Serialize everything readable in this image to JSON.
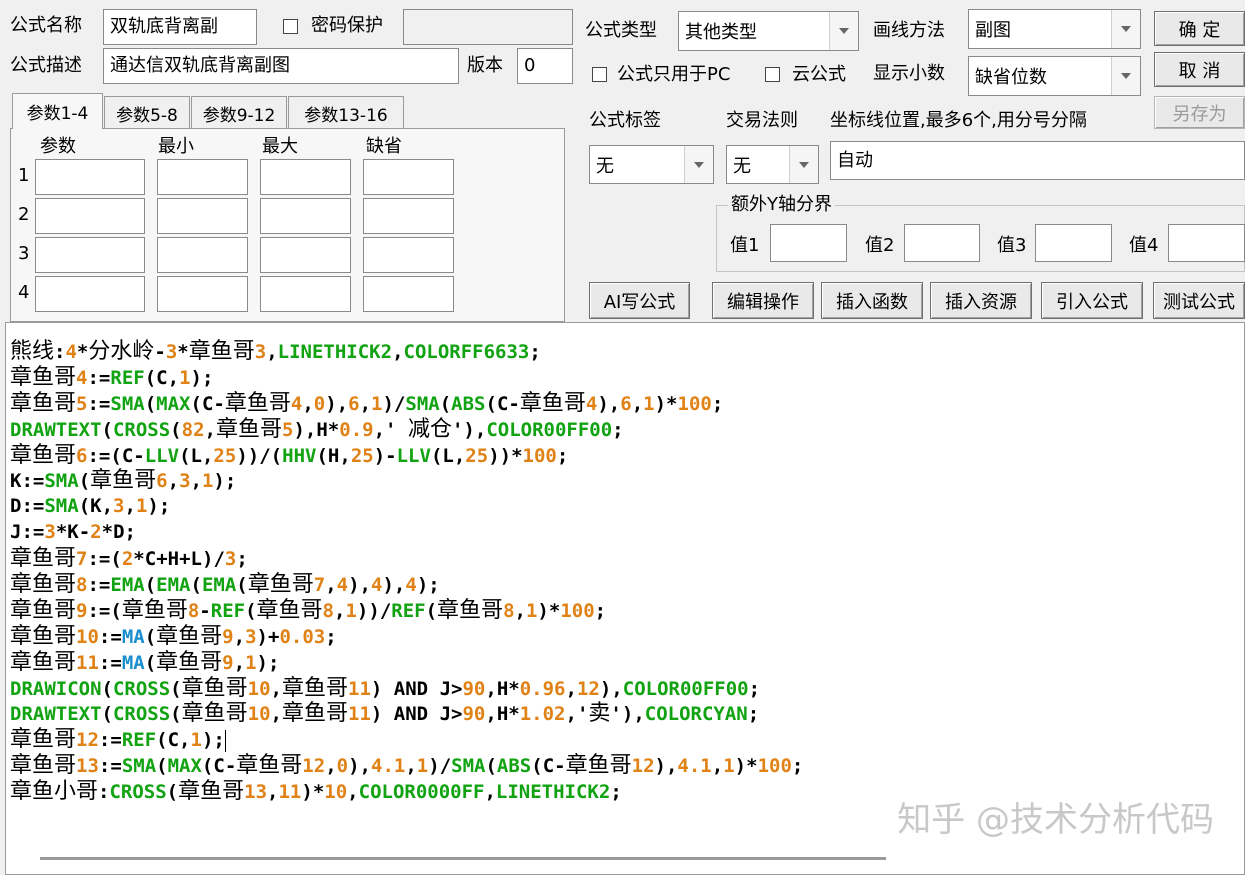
{
  "fields": {
    "name_label": "公式名称",
    "name_value": "双轨底背离副",
    "password_label": "密码保护",
    "desc_label": "公式描述",
    "desc_value": "通达信双轨底背离副图",
    "version_label": "版本",
    "version_value": "0"
  },
  "tabs": [
    "参数1-4",
    "参数5-8",
    "参数9-12",
    "参数13-16"
  ],
  "params": {
    "headers": [
      "参数",
      "最小",
      "最大",
      "缺省"
    ],
    "rows": [
      "1",
      "2",
      "3",
      "4"
    ]
  },
  "right": {
    "type_label": "公式类型",
    "type_value": "其他类型",
    "draw_label": "画线方法",
    "draw_value": "副图",
    "pc_only_label": "公式只用于PC",
    "cloud_label": "云公式",
    "decimals_label": "显示小数",
    "decimals_value": "缺省位数",
    "tag_label": "公式标签",
    "tag_value": "无",
    "trade_label": "交易法则",
    "trade_value": "无",
    "axis_label": "坐标线位置,最多6个,用分号分隔",
    "axis_value": "自动",
    "yaxis_group": "额外Y轴分界",
    "y_values": [
      "值1",
      "值2",
      "值3",
      "值4"
    ]
  },
  "buttons": {
    "ok": "确  定",
    "cancel": "取  消",
    "save_as": "另存为",
    "ai": "AI写公式",
    "edit": "编辑操作",
    "insert_func": "插入函数",
    "insert_res": "插入资源",
    "import": "引入公式",
    "test": "测试公式"
  },
  "code_lines": [
    "熊线:4*分水岭-3*章鱼哥3,LINETHICK2,COLORFF6633;",
    "章鱼哥4:=REF(C,1);",
    "章鱼哥5:=SMA(MAX(C-章鱼哥4,0),6,1)/SMA(ABS(C-章鱼哥4),6,1)*100;",
    "DRAWTEXT(CROSS(82,章鱼哥5),H*0.9,' 减仓'),COLOR00FF00;",
    "章鱼哥6:=(C-LLV(L,25))/(HHV(H,25)-LLV(L,25))*100;",
    "K:=SMA(章鱼哥6,3,1);",
    "D:=SMA(K,3,1);",
    "J:=3*K-2*D;",
    "章鱼哥7:=(2*C+H+L)/3;",
    "章鱼哥8:=EMA(EMA(EMA(章鱼哥7,4),4),4);",
    "章鱼哥9:=(章鱼哥8-REF(章鱼哥8,1))/REF(章鱼哥8,1)*100;",
    "章鱼哥10:=MA(章鱼哥9,3)+0.03;",
    "章鱼哥11:=MA(章鱼哥9,1);",
    "DRAWICON(CROSS(章鱼哥10,章鱼哥11) AND J>90,H*0.96,12),COLOR00FF00;",
    "DRAWTEXT(CROSS(章鱼哥10,章鱼哥11) AND J>90,H*1.02,'卖'),COLORCYAN;",
    "章鱼哥12:=REF(C,1);",
    "章鱼哥13:=SMA(MAX(C-章鱼哥12,0),4.1,1)/SMA(ABS(C-章鱼哥12),4.1,1)*100;",
    "章鱼小哥:CROSS(章鱼哥13,11)*10,COLOR0000FF,LINETHICK2;"
  ],
  "watermark": "知乎 @技术分析代码",
  "colors": {
    "keyword": "#11a311",
    "number": "#e08216",
    "function_ma": "#1a8ecf",
    "text": "#000000",
    "window_bg": "#f0f0f0"
  }
}
